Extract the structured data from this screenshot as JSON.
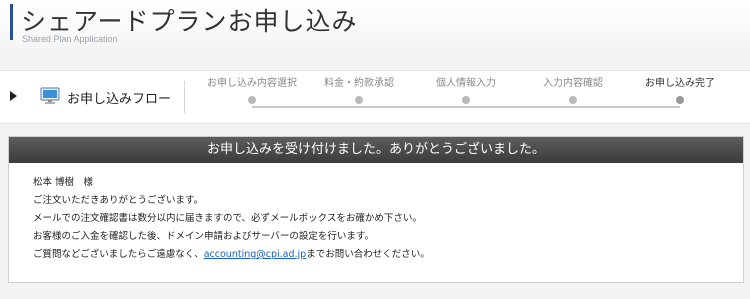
{
  "header": {
    "title": "シェアードプランお申し込み",
    "subtitle": "Shared Plan Application"
  },
  "flow": {
    "label": "お申し込みフロー",
    "steps": [
      {
        "label": "お申し込み内容選択",
        "active": false
      },
      {
        "label": "料金・約款承認",
        "active": false
      },
      {
        "label": "個人情報入力",
        "active": false
      },
      {
        "label": "入力内容確認",
        "active": false
      },
      {
        "label": "お申し込み完了",
        "active": true
      }
    ]
  },
  "result": {
    "heading": "お申し込みを受け付けました。ありがとうございました。",
    "recipient": "松本 博樹　様",
    "line1": "ご注文いただきありがとうございます。",
    "line2": "メールでの注文確認書は数分以内に届きますので、必ずメールボックスをお確かめ下さい。",
    "line3": "お客様のご入金を確認した後、ドメイン申請およびサーバーの設定を行います。",
    "line4_prefix": "ご質問などございましたらご遠慮なく、",
    "email": "accounting@cpi.ad.jp",
    "line4_suffix": "までお問い合わせください。"
  },
  "colors": {
    "accent": "#2a4f9a",
    "heading_bar": "#4a4a4a",
    "link": "#1a5fc0"
  },
  "icons": {
    "flow_arrow": "triangle-right-icon",
    "flow_icon": "monitor-icon"
  }
}
